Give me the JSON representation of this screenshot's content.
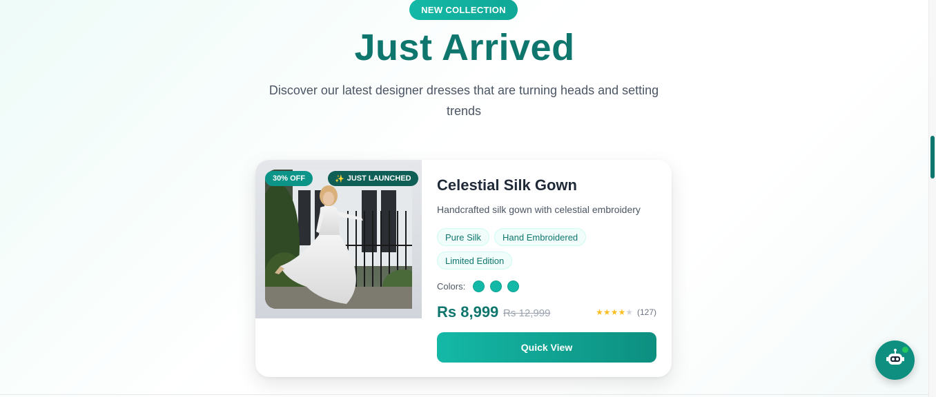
{
  "header": {
    "badge": "NEW COLLECTION",
    "title": "Just Arrived",
    "subtitle": "Discover our latest designer dresses that are turning heads and setting trends"
  },
  "product": {
    "discount_badge": "30% OFF",
    "launch_badge_icon": "sparkles-icon",
    "launch_badge": "JUST LAUNCHED",
    "name": "Celestial Silk Gown",
    "description": "Handcrafted silk gown with celestial embroidery",
    "features": [
      "Pure Silk",
      "Hand Embroidered",
      "Limited Edition"
    ],
    "colors_label": "Colors:",
    "colors": [
      "#14b8a6",
      "#14b8a6",
      "#14b8a6"
    ],
    "price": "Rs 8,999",
    "original_price": "Rs 12,999",
    "rating": 4,
    "rating_max": 5,
    "review_count": "(127)",
    "cta": "Quick View"
  },
  "chat": {
    "icon": "robot-icon"
  },
  "theme": {
    "accent": "#0f766e",
    "accent_light": "#14b8a6"
  }
}
